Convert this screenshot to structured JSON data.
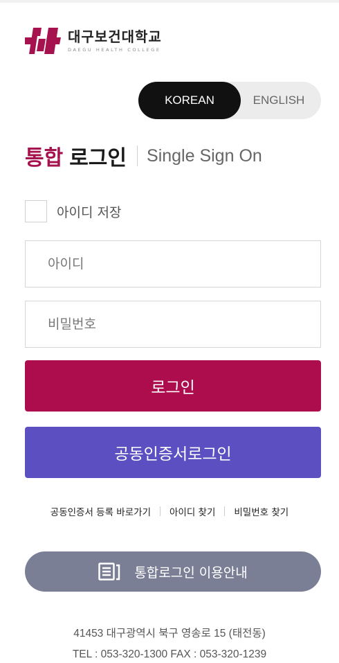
{
  "logo": {
    "name_ko": "대구보건대학교",
    "name_en": "DAEGU HEALTH COLLEGE",
    "icon": "college-logo-mark",
    "brand_color": "#a5124e"
  },
  "language": {
    "options": [
      "KOREAN",
      "ENGLISH"
    ],
    "selected": "KOREAN"
  },
  "heading": {
    "accent": "통합",
    "main": "로그인",
    "sub": "Single Sign On"
  },
  "remember": {
    "label": "아이디 저장",
    "checked": false
  },
  "form": {
    "id_placeholder": "아이디",
    "id_value": "",
    "password_placeholder": "비밀번호",
    "password_value": ""
  },
  "buttons": {
    "login": "로그인",
    "login_color": "#ad0d4c",
    "certificate_login": "공동인증서로그인",
    "certificate_color": "#5b4fc1"
  },
  "links": [
    "공동인증서 등록 바로가기",
    "아이디 찾기",
    "비밀번호 찾기"
  ],
  "guide": {
    "label": "통합로그인 이용안내",
    "icon": "document-list-icon"
  },
  "footer": {
    "address": "41453 대구광역시 북구 영송로 15 (태전동)",
    "contact": "TEL : 053-320-1300  FAX : 053-320-1239"
  }
}
